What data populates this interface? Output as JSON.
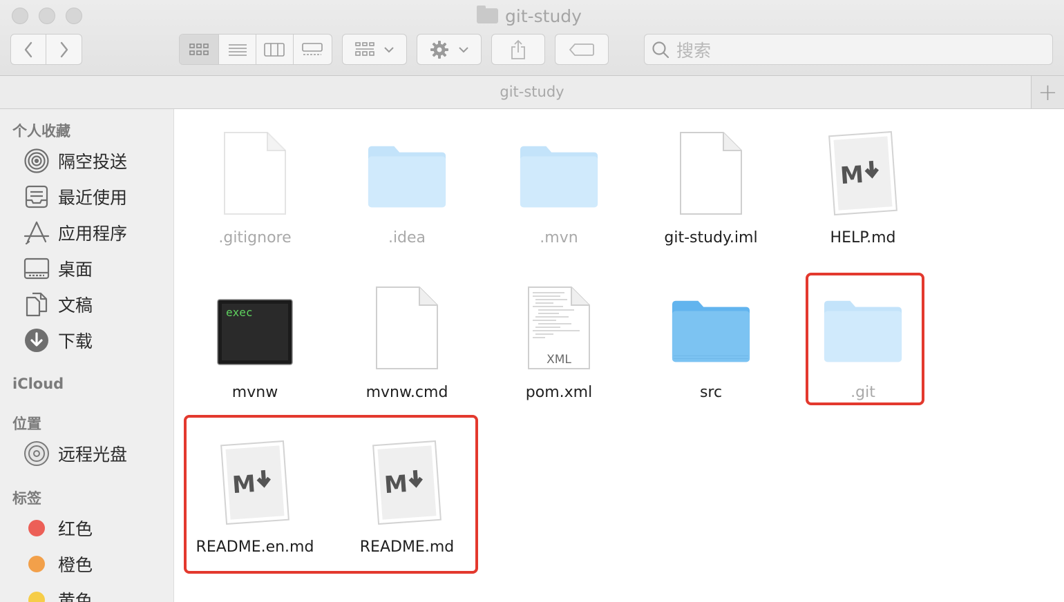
{
  "window": {
    "title": "git-study",
    "path_title": "git-study",
    "new_tab_symbol": "+"
  },
  "toolbar": {
    "search_placeholder": "搜索"
  },
  "sidebar": {
    "favorites_header": "个人收藏",
    "favorites": [
      {
        "label": "隔空投送",
        "icon": "airdrop-icon"
      },
      {
        "label": "最近使用",
        "icon": "recents-icon"
      },
      {
        "label": "应用程序",
        "icon": "applications-icon"
      },
      {
        "label": "桌面",
        "icon": "desktop-icon"
      },
      {
        "label": "文稿",
        "icon": "documents-icon"
      },
      {
        "label": "下载",
        "icon": "downloads-icon"
      }
    ],
    "icloud_header": "iCloud",
    "locations_header": "位置",
    "locations": [
      {
        "label": "远程光盘",
        "icon": "remote-disc-icon"
      }
    ],
    "tags_header": "标签",
    "tags": [
      {
        "label": "红色",
        "color": "#ec5f57"
      },
      {
        "label": "橙色",
        "color": "#f2a04a"
      },
      {
        "label": "黄色",
        "color": "#f6cd48"
      }
    ]
  },
  "files": [
    {
      "name": ".gitignore",
      "kind": "document",
      "hidden": true
    },
    {
      "name": ".idea",
      "kind": "folder",
      "hidden": true
    },
    {
      "name": ".mvn",
      "kind": "folder",
      "hidden": true
    },
    {
      "name": "git-study.iml",
      "kind": "document",
      "hidden": false
    },
    {
      "name": "HELP.md",
      "kind": "markdown",
      "hidden": false
    },
    {
      "name": "mvnw",
      "kind": "exec",
      "hidden": false,
      "badge": "exec"
    },
    {
      "name": "mvnw.cmd",
      "kind": "document",
      "hidden": false
    },
    {
      "name": "pom.xml",
      "kind": "xml",
      "hidden": false,
      "badge": "XML"
    },
    {
      "name": "src",
      "kind": "folder",
      "hidden": false
    },
    {
      "name": ".git",
      "kind": "folder",
      "hidden": true
    },
    {
      "name": "README.en.md",
      "kind": "markdown",
      "hidden": false
    },
    {
      "name": "README.md",
      "kind": "markdown",
      "hidden": false
    }
  ],
  "colors": {
    "highlight": "#e3392e",
    "folder": "#7cc3f2"
  }
}
